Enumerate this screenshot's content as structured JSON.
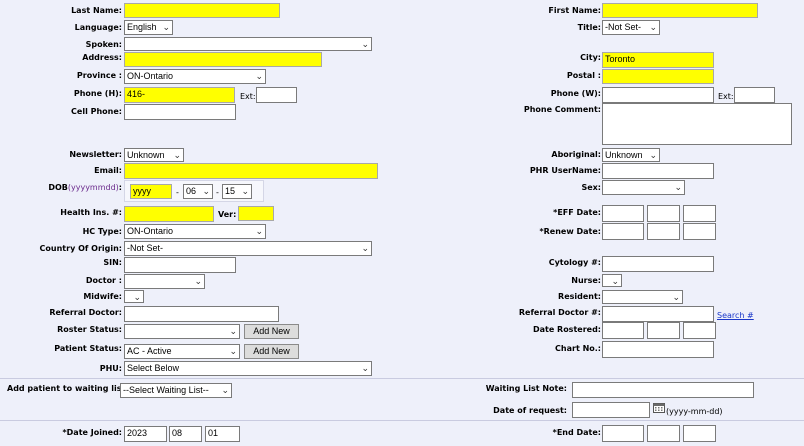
{
  "left": {
    "last_name_label": "Last Name:",
    "language_label": "Language:",
    "language_value": "English",
    "spoken_label": "Spoken:",
    "address_label": "Address:",
    "province_label": "Province :",
    "province_value": "ON-Ontario",
    "phone_h_label": "Phone (H):",
    "phone_h_value": "416-",
    "ext_label": "Ext:",
    "cell_label": "Cell Phone:",
    "newsletter_label": "Newsletter:",
    "newsletter_value": "Unknown",
    "email_label": "Email:",
    "dob_label": "DOB",
    "dob_hint": "(yyyymmdd)",
    "dob_colon": ":",
    "dob_year_placeholder": "yyyy",
    "dob_month": "06",
    "dob_day": "15",
    "dash": "-",
    "health_label": "Health Ins. #:",
    "ver_label": "Ver:",
    "hc_type_label": "HC Type:",
    "hc_type_value": "ON-Ontario",
    "country_label": "Country Of Origin:",
    "country_value": "-Not Set-",
    "sin_label": "SIN:",
    "doctor_label": "Doctor :",
    "midwife_label": "Midwife:",
    "referral_doctor_label": "Referral Doctor:",
    "roster_label": "Roster Status:",
    "add_new": "Add New",
    "patient_status_label": "Patient Status:",
    "patient_status_value": "AC - Active",
    "phu_label": "PHU:",
    "phu_value": "Select Below",
    "waiting_list_label": "Add patient to waiting list:",
    "waiting_list_value": "--Select Waiting List--",
    "date_joined_label": "*Date Joined:",
    "date_joined_year": "2023",
    "date_joined_month": "08",
    "date_joined_day": "01"
  },
  "right": {
    "first_name_label": "First Name:",
    "title_label": "Title:",
    "title_value": "-Not Set-",
    "city_label": "City:",
    "city_value": "Toronto",
    "postal_label": "Postal :",
    "phone_w_label": "Phone (W):",
    "ext_label": "Ext:",
    "phone_comment_label": "Phone Comment:",
    "aboriginal_label": "Aboriginal:",
    "aboriginal_value": "Unknown",
    "phr_label": "PHR UserName:",
    "sex_label": "Sex:",
    "eff_date_label": "*EFF Date:",
    "renew_date_label": "*Renew Date:",
    "cytology_label": "Cytology #:",
    "nurse_label": "Nurse:",
    "resident_label": "Resident:",
    "referral_doctor_num_label": "Referral Doctor #:",
    "search_link": "Search #",
    "date_rostered_label": "Date Rostered:",
    "chart_no_label": "Chart No.:",
    "waiting_note_label": "Waiting List Note:",
    "date_request_label": "Date of request:",
    "date_request_hint": "(yyyy-mm-dd)",
    "end_date_label": "*End Date:"
  },
  "icons": {
    "calendar": "calendar-icon",
    "dropdown": "chevron-down-icon"
  },
  "colors": {
    "required": "#ffff00",
    "background": "#eef0fa",
    "link": "#1a37c9"
  }
}
